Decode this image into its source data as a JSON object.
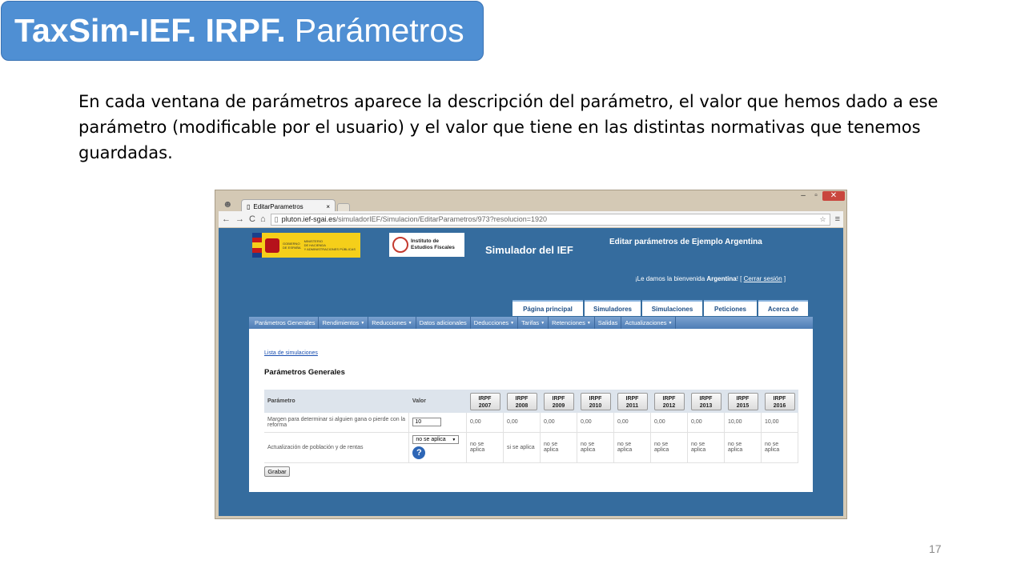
{
  "slide": {
    "title_bold": "TaxSim-IEF. IRPF.",
    "title_rest": "Parámetros",
    "intro": "En cada ventana de parámetros aparece la descripción del parámetro, el valor que hemos dado a ese parámetro (modificable por el usuario) y el valor que tiene en las distintas normativas que tenemos guardadas.",
    "page_number": "17"
  },
  "browser": {
    "tab_title": "EditarParametros",
    "tab_close": "×",
    "url_host": "pluton.ief-sgai.es",
    "url_path": "/simuladorIEF/Simulacion/EditarParametros/973?resolucion=1920",
    "win_minimize": "–",
    "win_maximize": "▫",
    "win_close": "✕",
    "icons": {
      "back": "←",
      "forward": "→",
      "reload": "C",
      "home": "⌂",
      "page": "▯",
      "star": "☆",
      "menu": "≡",
      "person": "☻",
      "tab_page": "▯"
    }
  },
  "site": {
    "gov_logo_text": [
      "GOBIERNO",
      "DE ESPAÑA",
      "MINISTERIO",
      "DE HACIENDA",
      "Y ADMINISTRACIONES PÚBLICAS"
    ],
    "ief_logo_text": [
      "Instituto de",
      "Estudios Fiscales"
    ],
    "title": "Simulador del IEF",
    "edit_title": "Editar parámetros de Ejemplo Argentina",
    "welcome_prefix": "¡Le damos la bienvenida ",
    "welcome_user": "Argentina",
    "welcome_suffix": "! [",
    "logout": "Cerrar sesión",
    "welcome_end": " ]"
  },
  "main_nav": [
    {
      "label": "Página principal",
      "width": 88
    },
    {
      "label": "Simuladores",
      "width": 70
    },
    {
      "label": "Simulaciones",
      "width": 75
    },
    {
      "label": "Peticiones",
      "width": 66
    },
    {
      "label": "Acerca de",
      "width": 62
    }
  ],
  "menu": [
    {
      "label": "Parámetros Generales",
      "caret": false
    },
    {
      "label": "Rendimientos",
      "caret": true
    },
    {
      "label": "Reducciones",
      "caret": true
    },
    {
      "label": "Datos adicionales",
      "caret": false
    },
    {
      "label": "Deducciones",
      "caret": true
    },
    {
      "label": "Tarifas",
      "caret": true
    },
    {
      "label": "Retenciones",
      "caret": true
    },
    {
      "label": "Salidas",
      "caret": false
    },
    {
      "label": "Actualizaciones",
      "caret": true
    }
  ],
  "panel": {
    "link": "Lista de simulaciones",
    "section_title": "Parámetros Generales",
    "col_param": "Parámetro",
    "col_value": "Valor",
    "years": [
      [
        "IRPF",
        "2007"
      ],
      [
        "IRPF",
        "2008"
      ],
      [
        "IRPF",
        "2009"
      ],
      [
        "IRPF",
        "2010"
      ],
      [
        "IRPF",
        "2011"
      ],
      [
        "IRPF",
        "2012"
      ],
      [
        "IRPF",
        "2013"
      ],
      [
        "IRPF",
        "2015"
      ],
      [
        "IRPF",
        "2016"
      ]
    ],
    "rows": [
      {
        "label": "Margen para determinar si alguien gana o pierde con la reforma",
        "input_value": "10",
        "values": [
          "0,00",
          "0,00",
          "0,00",
          "0,00",
          "0,00",
          "0,00",
          "0,00",
          "10,00",
          "10,00"
        ]
      },
      {
        "label": "Actualización de población y de rentas",
        "select_value": "no se aplica",
        "help_icon": "?",
        "values": [
          "no se aplica",
          "si se aplica",
          "no se aplica",
          "no se aplica",
          "no se aplica",
          "no se aplica",
          "no se aplica",
          "no se aplica",
          "no se aplica"
        ]
      }
    ],
    "save_label": "Grabar"
  }
}
